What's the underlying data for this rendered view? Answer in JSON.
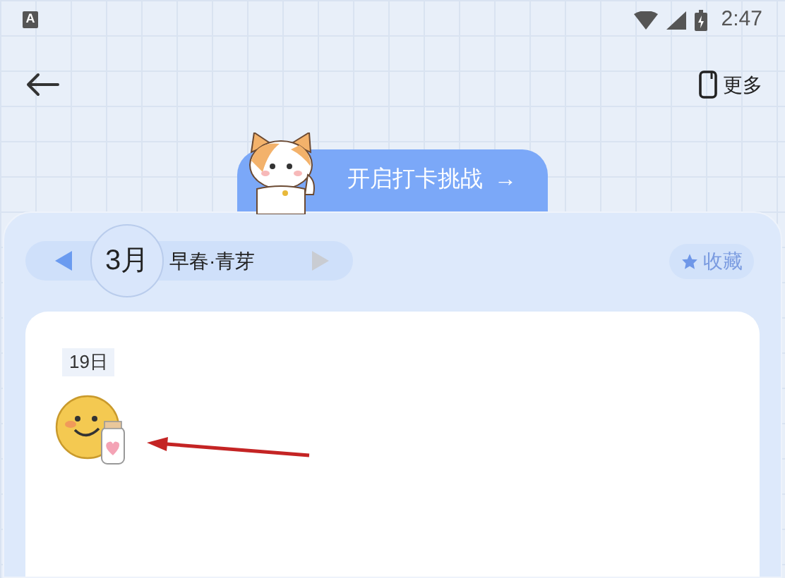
{
  "status_bar": {
    "app_badge": "A",
    "time": "2:47"
  },
  "header": {
    "more_label": "更多"
  },
  "challenge_button": {
    "label": "开启打卡挑战",
    "arrow": "→"
  },
  "month_nav": {
    "month": "3月",
    "season": "早春·青芽",
    "prev_disabled": false,
    "next_disabled": true
  },
  "favorite_button": {
    "label": "收藏"
  },
  "entries": [
    {
      "date": "19日"
    }
  ]
}
